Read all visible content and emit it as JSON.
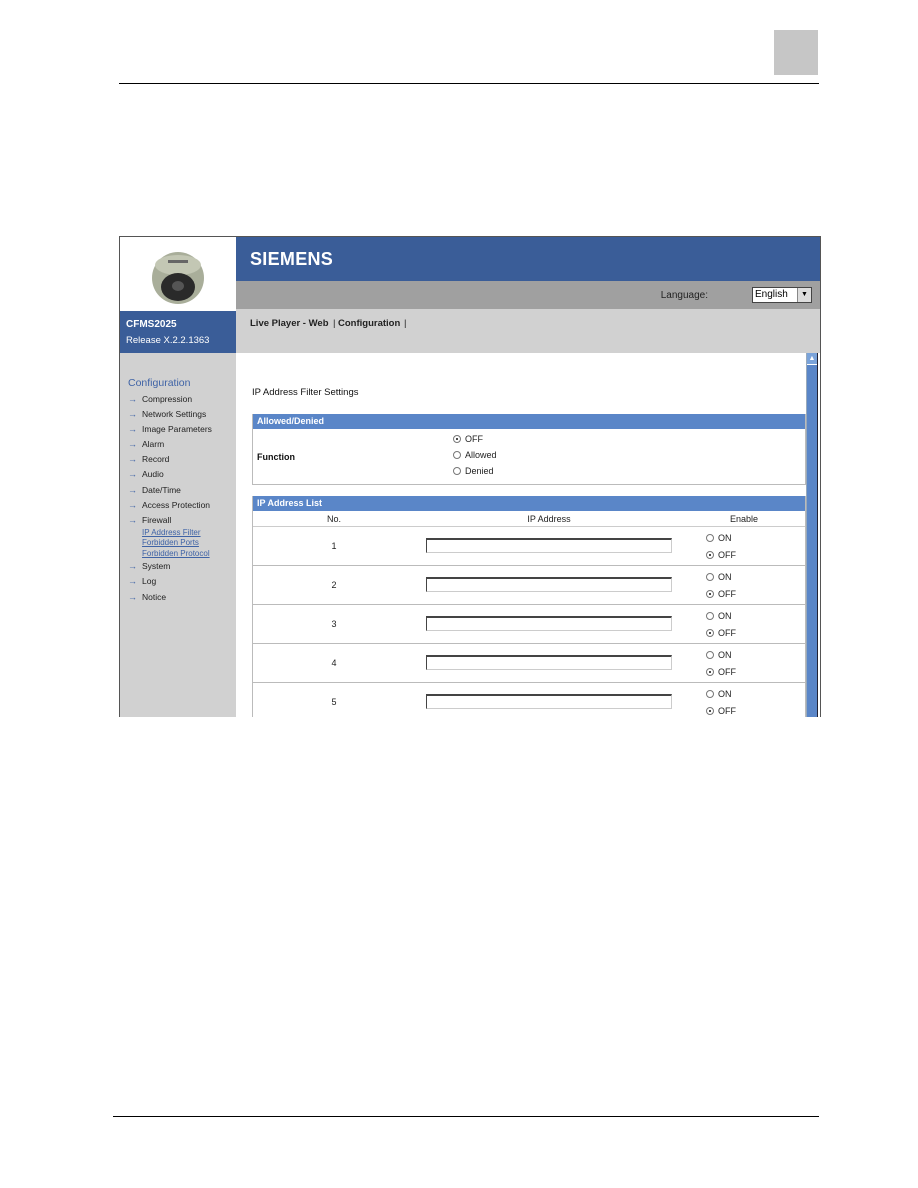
{
  "app": {
    "brand": "SIEMENS",
    "model": "CFMS2025",
    "release": "Release X.2.2.1363"
  },
  "language": {
    "label": "Language:",
    "selected": "English"
  },
  "menubar": {
    "items": [
      "Live Player - Web",
      "|",
      "Configuration",
      "|"
    ]
  },
  "sidebar": {
    "title": "Configuration",
    "items": [
      {
        "label": "Compression"
      },
      {
        "label": "Network Settings"
      },
      {
        "label": "Image Parameters"
      },
      {
        "label": "Alarm"
      },
      {
        "label": "Record"
      },
      {
        "label": "Audio"
      },
      {
        "label": "Date/Time"
      },
      {
        "label": "Access Protection"
      },
      {
        "label": "Firewall"
      }
    ],
    "firewall_sub": [
      "IP Address Filter",
      "Forbidden Ports",
      "Forbidden Protocol"
    ],
    "items_after": [
      {
        "label": "System"
      },
      {
        "label": "Log"
      },
      {
        "label": "Notice"
      }
    ]
  },
  "page": {
    "title": "IP Address Filter Settings",
    "allowed_denied": {
      "header": "Allowed/Denied",
      "field_label": "Function",
      "options": [
        "OFF",
        "Allowed",
        "Denied"
      ],
      "selected": "OFF"
    },
    "ip_list": {
      "header": "IP Address List",
      "columns": [
        "No.",
        "IP Address",
        "Enable"
      ],
      "rows": [
        {
          "no": "1",
          "ip": "",
          "enable": "OFF"
        },
        {
          "no": "2",
          "ip": "",
          "enable": "OFF"
        },
        {
          "no": "3",
          "ip": "",
          "enable": "OFF"
        },
        {
          "no": "4",
          "ip": "",
          "enable": "OFF"
        },
        {
          "no": "5",
          "ip": "",
          "enable": "OFF"
        }
      ],
      "enable_options": [
        "ON",
        "OFF"
      ]
    }
  },
  "colors": {
    "brand_blue": "#3a5d98",
    "section_blue": "#5a86c8",
    "sidebar_gray": "#d1d1d1"
  }
}
